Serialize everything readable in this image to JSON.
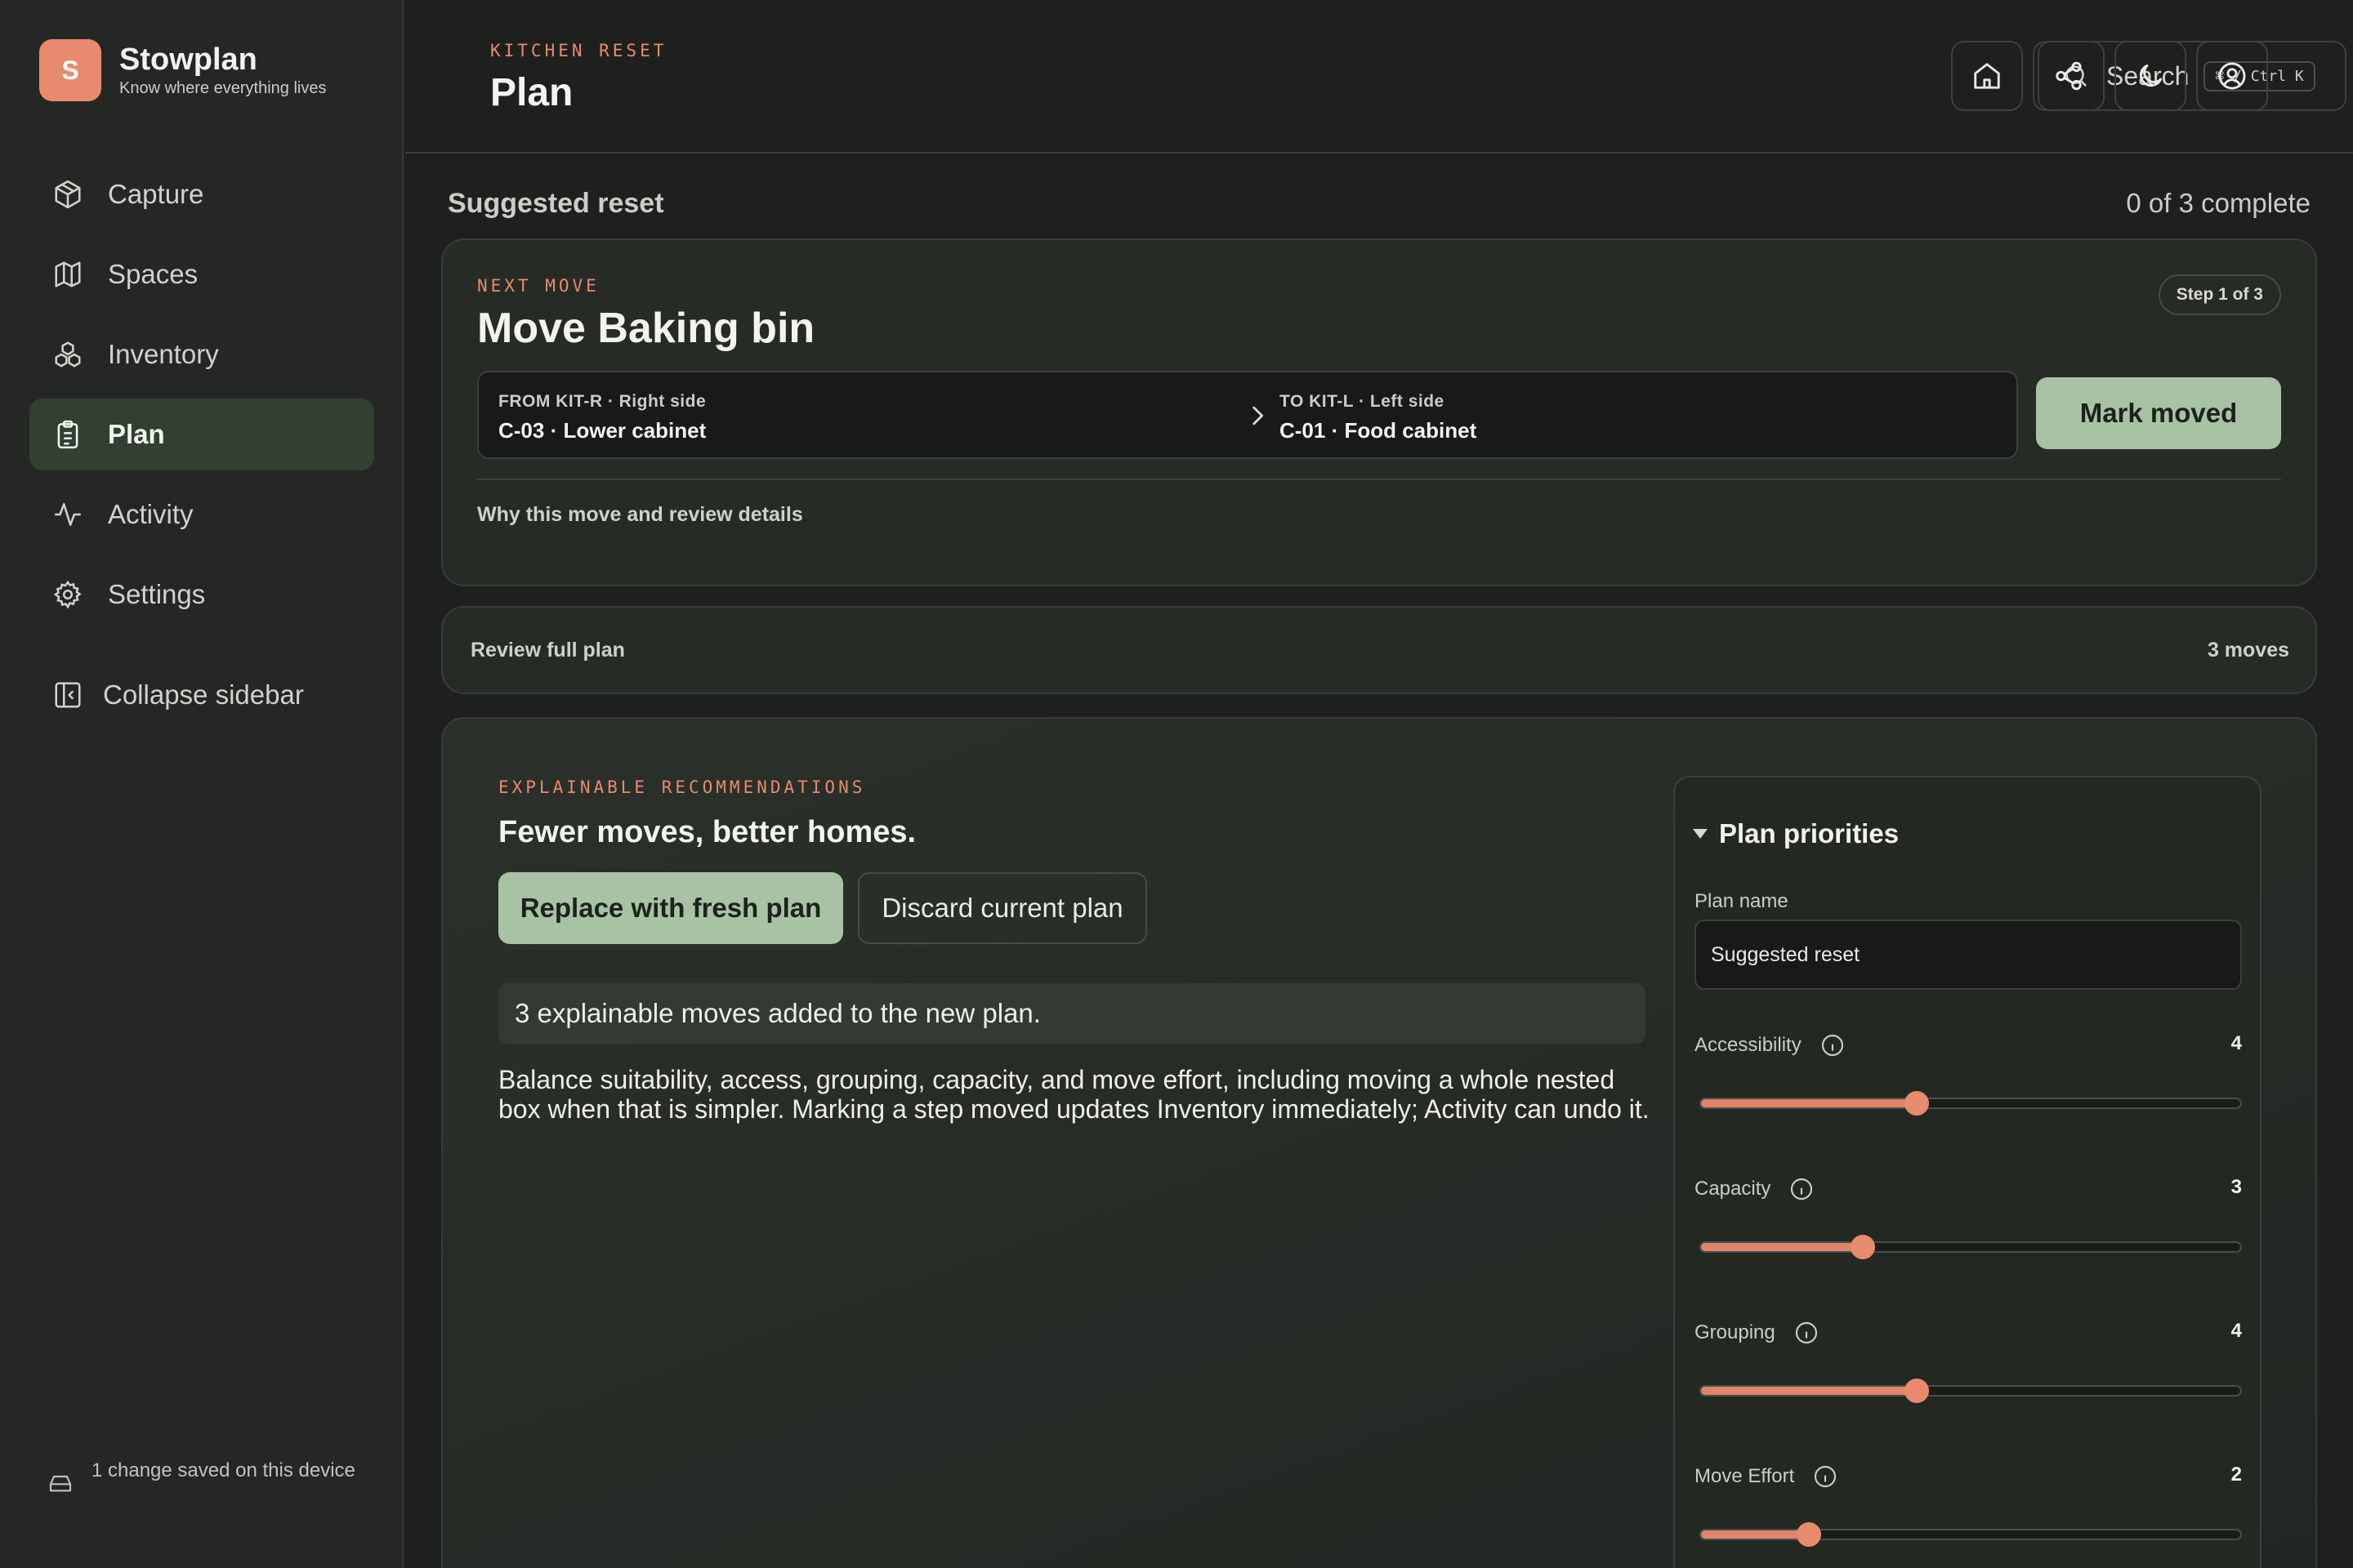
{
  "brand": {
    "initial": "S",
    "name": "Stowplan",
    "tagline": "Know where everything lives"
  },
  "nav": [
    {
      "label": "Capture",
      "icon": "package-icon",
      "active": false
    },
    {
      "label": "Spaces",
      "icon": "map-icon",
      "active": false
    },
    {
      "label": "Inventory",
      "icon": "boxes-icon",
      "active": false
    },
    {
      "label": "Plan",
      "icon": "clipboard-icon",
      "active": true
    },
    {
      "label": "Activity",
      "icon": "activity-icon",
      "active": false
    },
    {
      "label": "Settings",
      "icon": "gear-icon",
      "active": false
    }
  ],
  "collapse_label": "Collapse sidebar",
  "saved_status": "1 change saved on this device",
  "header": {
    "eyebrow": "KITCHEN RESET",
    "title": "Plan",
    "search_label": "Search",
    "search_shortcut": "⌘ / Ctrl K"
  },
  "plan": {
    "name": "Suggested reset",
    "progress": "0 of 3 complete"
  },
  "next_move": {
    "eyebrow": "NEXT MOVE",
    "title": "Move Baking bin",
    "step": "Step 1 of 3",
    "from_caption": "FROM KIT-R · Right side",
    "from_value": "C-03 · Lower cabinet",
    "to_caption": "TO KIT-L · Left side",
    "to_value": "C-01 · Food cabinet",
    "mark_label": "Mark moved",
    "why_label": "Why this move and review details"
  },
  "review": {
    "label": "Review full plan",
    "count": "3 moves"
  },
  "recommendations": {
    "eyebrow": "EXPLAINABLE RECOMMENDATIONS",
    "title": "Fewer moves, better homes.",
    "primary_label": "Replace with fresh plan",
    "secondary_label": "Discard current plan",
    "notice": "3 explainable moves added to the new plan.",
    "description": "Balance suitability, access, grouping, capacity, and move effort, including moving a whole nested box when that is simpler. Marking a step moved updates Inventory immediately; Activity can undo it."
  },
  "priorities": {
    "title": "Plan priorities",
    "name_label": "Plan name",
    "name_value": "Suggested reset",
    "sliders": [
      {
        "label": "Accessibility",
        "value": 4,
        "fraction": 0.4
      },
      {
        "label": "Capacity",
        "value": 3,
        "fraction": 0.3
      },
      {
        "label": "Grouping",
        "value": 4,
        "fraction": 0.4
      },
      {
        "label": "Move Effort",
        "value": 2,
        "fraction": 0.2
      }
    ]
  },
  "colors": {
    "accent": "#e88a6d",
    "primary": "#a8c3a4",
    "background": "#1e201e"
  }
}
